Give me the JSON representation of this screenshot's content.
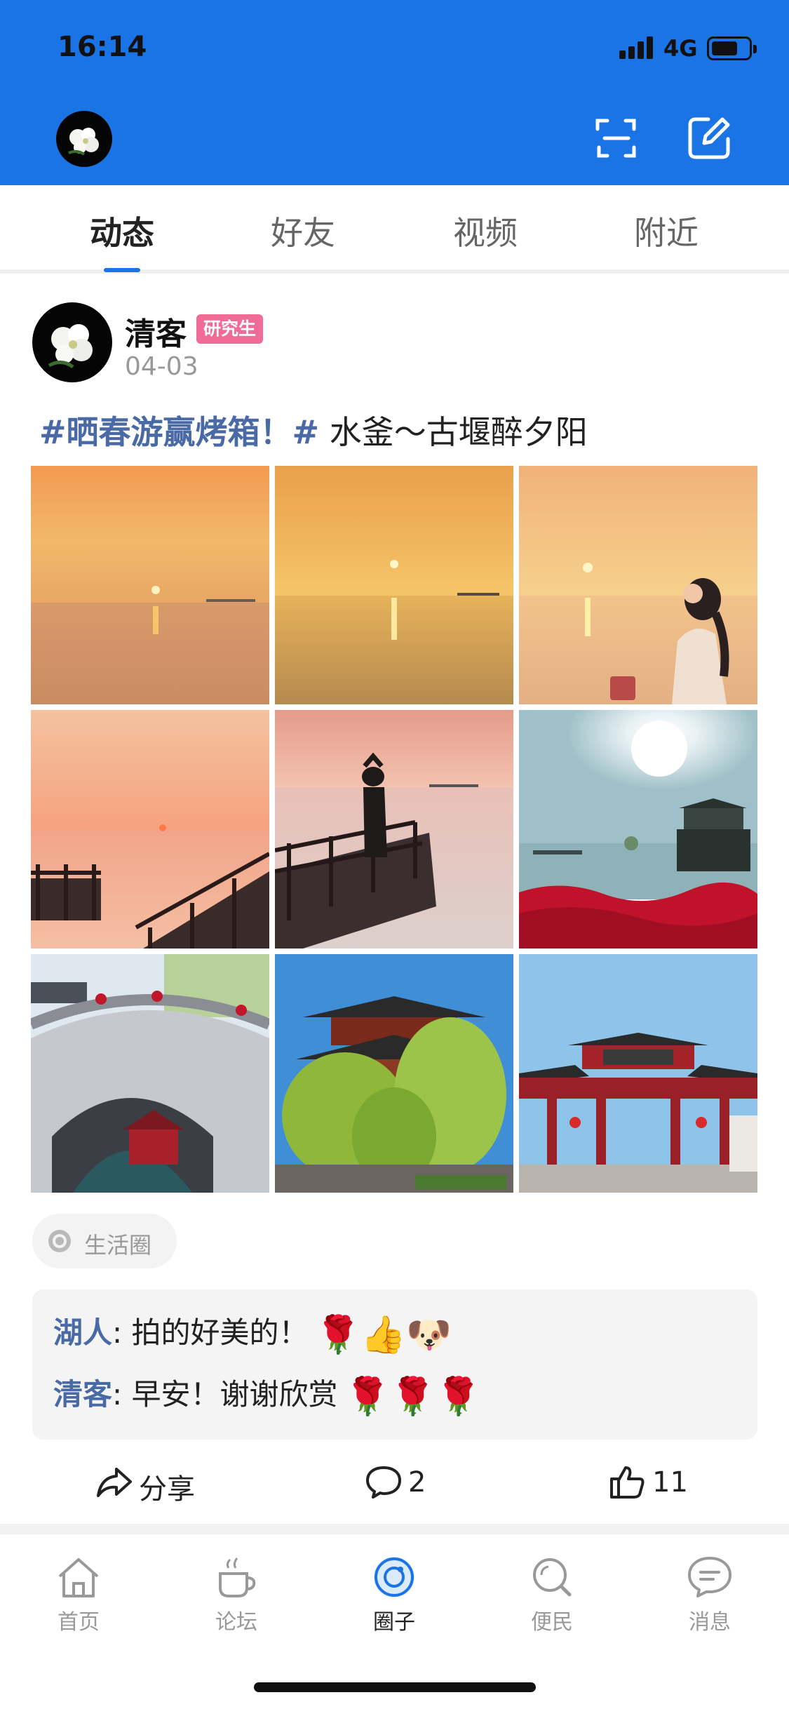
{
  "status_bar": {
    "time": "16:14",
    "network": "4G"
  },
  "header": {
    "scan_icon": "scan-icon",
    "edit_icon": "edit-icon",
    "bg_color": "#1a74e6"
  },
  "tabs": [
    {
      "label": "动态",
      "active": true
    },
    {
      "label": "好友",
      "active": false
    },
    {
      "label": "视频",
      "active": false
    },
    {
      "label": "附近",
      "active": false
    }
  ],
  "post": {
    "author": "清客",
    "badge": "研究生",
    "date": "04-03",
    "hashtag": "#晒春游赢烤箱！#",
    "text": " 水釜～古堰醉夕阳",
    "photos": [
      {
        "name": "sunset-lake-1"
      },
      {
        "name": "sunset-lake-2"
      },
      {
        "name": "sunset-lake-girl"
      },
      {
        "name": "sunset-pier"
      },
      {
        "name": "pier-silhouette"
      },
      {
        "name": "sunny-lake-red-flowers"
      },
      {
        "name": "stone-arch-bridge"
      },
      {
        "name": "pavilion-willows"
      },
      {
        "name": "red-memorial-gate"
      }
    ],
    "circle_label": "生活圈",
    "comments": [
      {
        "user": "湖人",
        "text": ": 拍的好美的！",
        "emojis": "🌹👍🐶"
      },
      {
        "user": "清客",
        "text": ": 早安！谢谢欣赏",
        "emojis": "🌹🌹🌹"
      }
    ],
    "actions": {
      "share": "分享",
      "comments": "2",
      "likes": "11"
    }
  },
  "bottom_nav": [
    {
      "label": "首页",
      "icon": "home-icon",
      "active": false
    },
    {
      "label": "论坛",
      "icon": "coffee-icon",
      "active": false
    },
    {
      "label": "圈子",
      "icon": "circle-icon",
      "active": true
    },
    {
      "label": "便民",
      "icon": "search-icon",
      "active": false
    },
    {
      "label": "消息",
      "icon": "message-icon",
      "active": false
    }
  ]
}
